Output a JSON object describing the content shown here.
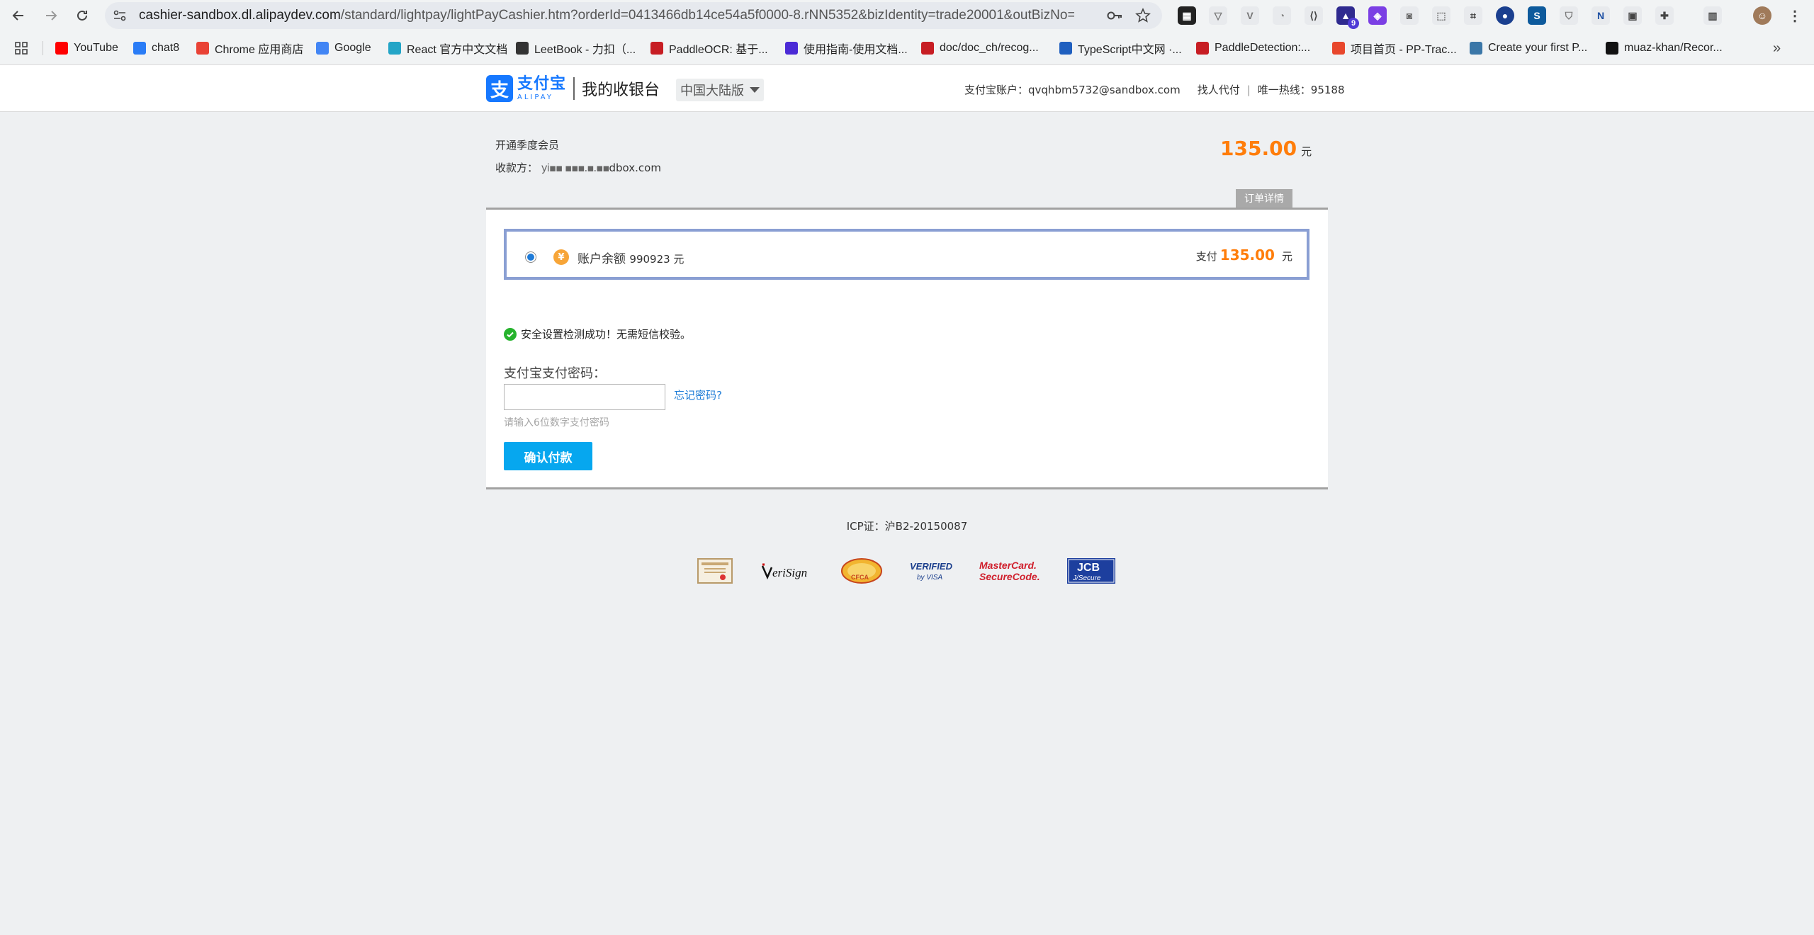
{
  "browser": {
    "url_host": "cashier-sandbox.dl.alipaydev.com",
    "url_rest": "/standard/lightpay/lightPayCashier.htm?orderId=0413466db14ce54a5f0000-8.rNN5352&bizIdentity=trade20001&outBizNo=...",
    "extension_badge": "9",
    "bookmarks": [
      {
        "label": "YouTube",
        "icon": "youtube-icon",
        "color": "#ff0000"
      },
      {
        "label": "chat8",
        "icon": "chat-icon",
        "color": "#2a7cf6"
      },
      {
        "label": "Chrome 应用商店",
        "icon": "chrome-store-icon",
        "color": "#e94235"
      },
      {
        "label": "Google",
        "icon": "google-icon",
        "color": "#4285f4"
      },
      {
        "label": "React 官方中文文档",
        "icon": "react-icon",
        "color": "#23a5c7"
      },
      {
        "label": "LeetBook - 力扣（...",
        "icon": "leetcode-icon",
        "color": "#333333"
      },
      {
        "label": "PaddleOCR: 基于...",
        "icon": "gitee-icon",
        "color": "#c71d23"
      },
      {
        "label": "使用指南-使用文档...",
        "icon": "doc-icon",
        "color": "#4b2ad6"
      },
      {
        "label": "doc/doc_ch/recog...",
        "icon": "gitee-icon",
        "color": "#c71d23"
      },
      {
        "label": "TypeScript中文网 ·...",
        "icon": "typescript-icon",
        "color": "#1f5fbf"
      },
      {
        "label": "PaddleDetection:...",
        "icon": "gitee-icon",
        "color": "#c71d23"
      },
      {
        "label": "项目首页 - PP-Trac...",
        "icon": "gitcode-icon",
        "color": "#e8472c"
      },
      {
        "label": "Create your first P...",
        "icon": "python-icon",
        "color": "#3b77a8"
      },
      {
        "label": "muaz-khan/Recor...",
        "icon": "github-icon",
        "color": "#111111"
      }
    ]
  },
  "header": {
    "logo_cn": "支付宝",
    "logo_en": "ALIPAY",
    "logo_mark": "支",
    "title": "我的收银台",
    "region": "中国大陆版",
    "account_label": "支付宝账户：",
    "account": "qvqhbm5732@sandbox.com",
    "proxy_pay": "找人代付",
    "hotline": "唯一热线：95188"
  },
  "order": {
    "title": "开通季度会员",
    "payee_label": "收款方：",
    "payee_masked": "yi▪▪  ▪▪▪.▪.▪▪",
    "payee_suffix": "dbox.com",
    "amount": "135.00",
    "currency_unit": "元",
    "detail_button": "订单详情"
  },
  "payment": {
    "method_label": "账户余额",
    "balance": "990923 元",
    "pay_label": "支付",
    "amount": "135.00",
    "unit": "元",
    "security_msg": "安全设置检测成功！无需短信校验。",
    "password_label": "支付宝支付密码：",
    "password_value": "",
    "forgot_link": "忘记密码?",
    "password_hint": "请输入6位数字支付密码",
    "confirm_button": "确认付款"
  },
  "footer": {
    "icp": "ICP证：沪B2-20150087",
    "badges": [
      "certificate-badge",
      "verisign-badge",
      "cfca-badge",
      "verified-by-visa-badge",
      "mastercard-securecode-badge",
      "jcb-jsecure-badge"
    ]
  },
  "colors": {
    "accent_orange": "#ff7d0a",
    "brand_blue": "#1678ff",
    "button_blue": "#06a7ef",
    "link_blue": "#1a7ad6",
    "method_border": "#8a9fd3"
  }
}
